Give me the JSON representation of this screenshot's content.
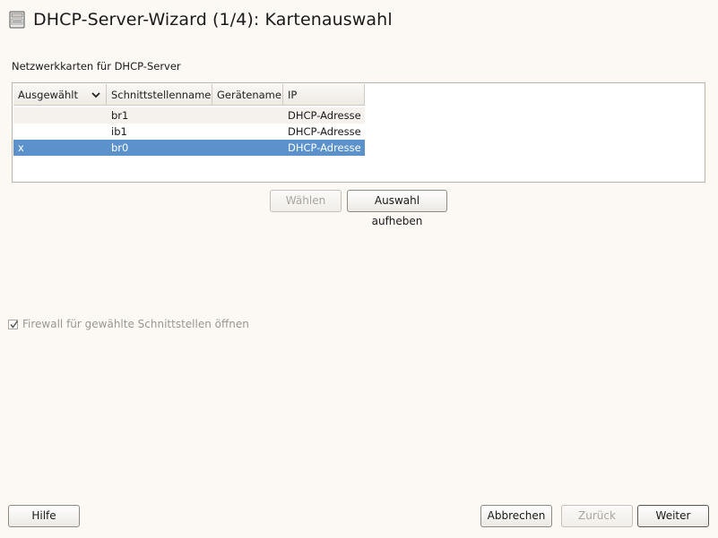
{
  "window": {
    "title": "DHCP-Server-Wizard (1/4): Kartenauswahl",
    "icon": "server-rack-icon"
  },
  "cards": {
    "label": "Netzwerkkarten für DHCP-Server",
    "columns": [
      "Ausgewählt",
      "Schnittstellenname",
      "Gerätename",
      "IP"
    ],
    "sort_icon": "chevron-down-icon",
    "rows": [
      {
        "selected": "",
        "interface": "br1",
        "device": "",
        "ip": "DHCP-Adresse"
      },
      {
        "selected": "",
        "interface": "ib1",
        "device": "",
        "ip": "DHCP-Adresse"
      },
      {
        "selected": "x",
        "interface": "br0",
        "device": "",
        "ip": "DHCP-Adresse"
      }
    ],
    "highlighted_row": 2,
    "select_button": "Wählen",
    "deselect_button": "Auswahl aufheben"
  },
  "firewall": {
    "label": "Firewall für gewählte Schnittstellen öffnen",
    "checked": true,
    "enabled": false
  },
  "footer": {
    "help": "Hilfe",
    "abort": "Abbrechen",
    "back": "Zurück",
    "next": "Weiter"
  },
  "colors": {
    "selection": "#5b92cc",
    "background": "#fcf9f5"
  }
}
